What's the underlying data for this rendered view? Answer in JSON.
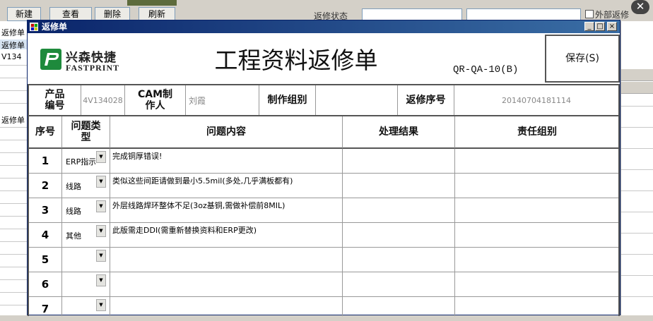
{
  "background_window": {
    "toolbar_buttons": [
      "新建",
      "查看",
      "删除",
      "刷新"
    ],
    "partial_label": "返修状态",
    "partial_checkbox_label": "外部返修",
    "left_column": [
      "返修单",
      "返修单",
      "V134",
      "返修单"
    ]
  },
  "dialog": {
    "title": "返修单",
    "window_buttons": {
      "minimize": "_",
      "maximize": "□",
      "close": "×"
    },
    "logo": {
      "cn": "兴森快捷",
      "en": "FASTPRINT"
    },
    "main_title": "工程资料返修单",
    "doc_code": "QR-QA-10(B)",
    "save_label": "保存(S)"
  },
  "info": {
    "product_no_label": "产品编号",
    "product_no_value": "4V134028",
    "cam_label": "CAM制作人",
    "cam_value": "刘霞",
    "group_label": "制作组别",
    "group_value": "",
    "seq_label": "返修序号",
    "seq_value": "20140704181114"
  },
  "table": {
    "headers": {
      "no": "序号",
      "type": "问题类型",
      "issue": "问题内容",
      "result": "处理结果",
      "responsible": "责任组别"
    },
    "rows": [
      {
        "no": "1",
        "type": "ERP指示",
        "issue": "完成铜厚错误!",
        "result": "",
        "responsible": ""
      },
      {
        "no": "2",
        "type": "线路",
        "issue": "类似这些间距请做到最小5.5mil(多处,几乎满板都有)",
        "result": "",
        "responsible": ""
      },
      {
        "no": "3",
        "type": "线路",
        "issue": "外层线路焊环整体不足(3oz基铜,需做补偿前8MIL)",
        "result": "",
        "responsible": ""
      },
      {
        "no": "4",
        "type": "其他",
        "issue": "此版需走DDI(需重新替换资料和ERP更改)",
        "result": "",
        "responsible": ""
      },
      {
        "no": "5",
        "type": "",
        "issue": "",
        "result": "",
        "responsible": ""
      },
      {
        "no": "6",
        "type": "",
        "issue": "",
        "result": "",
        "responsible": ""
      },
      {
        "no": "7",
        "type": "",
        "issue": "",
        "result": "",
        "responsible": ""
      }
    ]
  },
  "colors": {
    "titlebar_start": "#0a246a",
    "titlebar_end": "#3a6ea5",
    "logo_green": "#1e8a3c",
    "grid_line": "#999999"
  }
}
